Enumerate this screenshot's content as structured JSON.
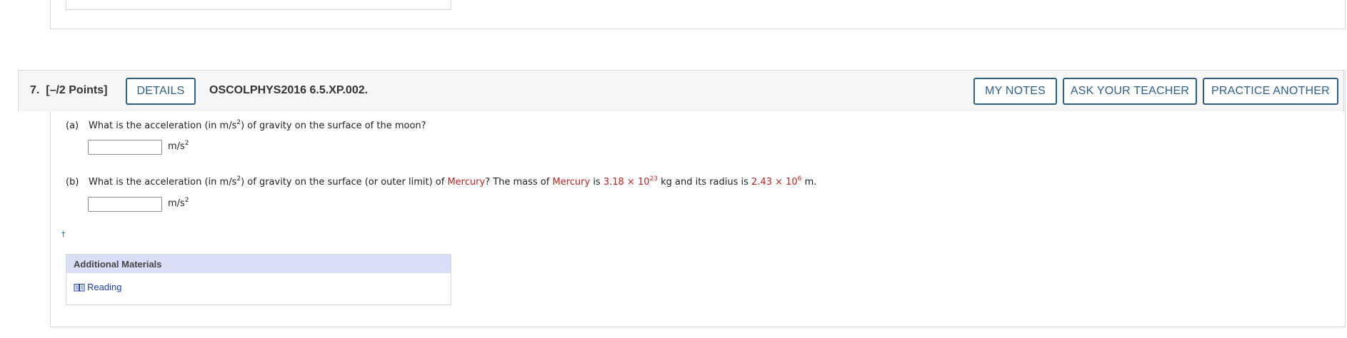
{
  "question": {
    "number_label": "7.",
    "points_label": "[–/2 Points]",
    "details_button": "DETAILS",
    "code": "OSCOLPHYS2016 6.5.XP.002.",
    "my_notes_button": "MY NOTES",
    "ask_teacher_button": "ASK YOUR TEACHER",
    "practice_another_button": "PRACTICE ANOTHER"
  },
  "part_a": {
    "label": "(a)",
    "text_1": "What is the acceleration (in m/s",
    "sup_1": "2",
    "text_2": ") of gravity on the surface of the moon?",
    "answer_value": "",
    "unit": "m/s",
    "unit_sup": "2"
  },
  "part_b": {
    "label": "(b)",
    "text_1": "What is the acceleration (in m/s",
    "sup_1": "2",
    "text_2": ") of gravity on the surface (or outer limit) of ",
    "planet_1": "Mercury",
    "text_3": "? The mass of ",
    "planet_2": "Mercury",
    "text_4": " is ",
    "mass_mantissa": "3.18 × 10",
    "mass_exp": "23",
    "text_5": " kg and its radius is ",
    "radius_mantissa": "2.43 × 10",
    "radius_exp": "6",
    "text_6": " m.",
    "answer_value": "",
    "unit": "m/s",
    "unit_sup": "2"
  },
  "footnote_mark": "†",
  "additional_materials": {
    "title": "Additional Materials",
    "link_label": "Reading"
  },
  "colors": {
    "accent": "#2d5f8a",
    "highlight_red": "#c8201e",
    "link_blue": "#1a3fb5",
    "materials_header_bg": "#d8def5"
  }
}
